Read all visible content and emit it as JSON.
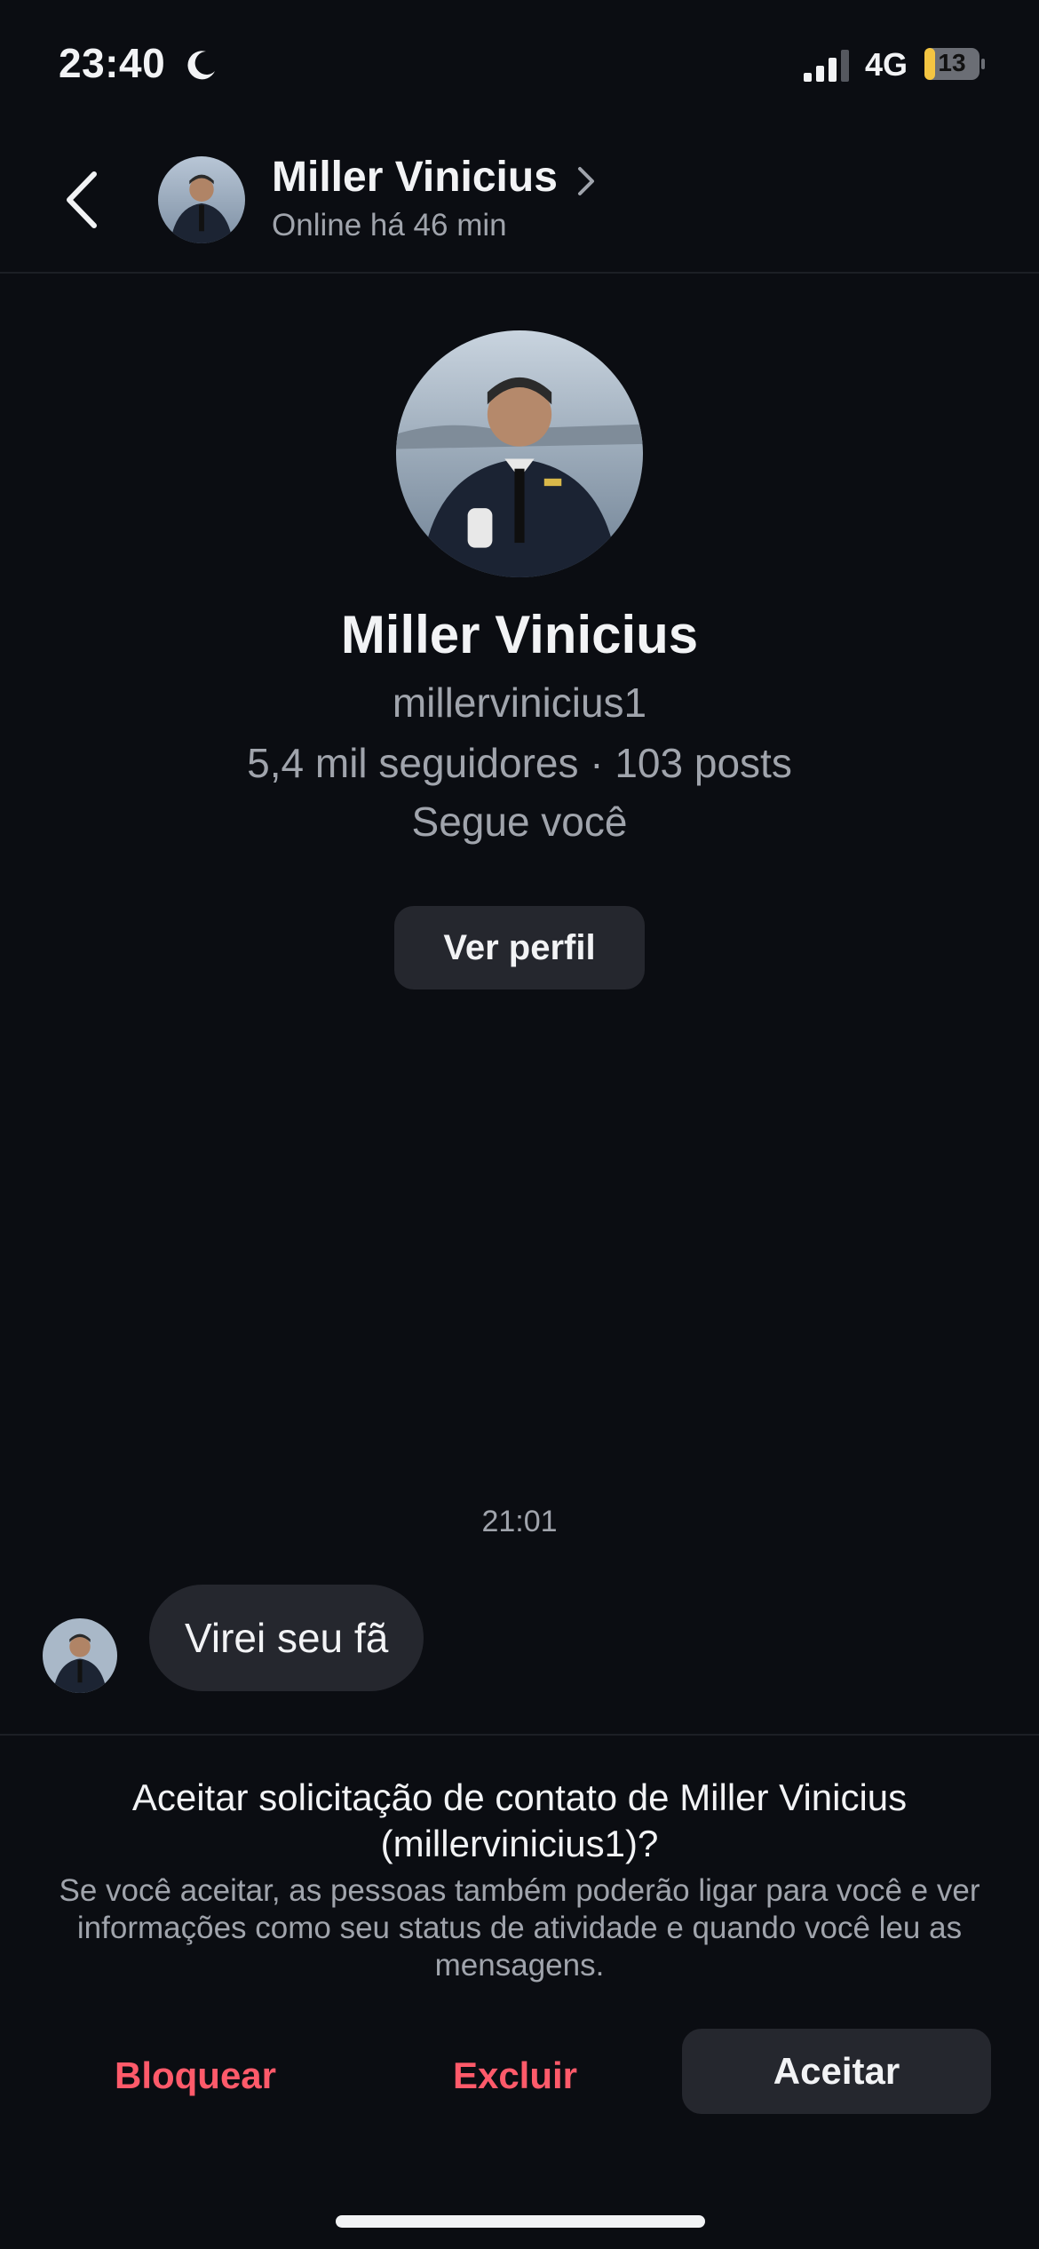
{
  "status_bar": {
    "time": "23:40",
    "network": "4G",
    "battery": "13",
    "icons": [
      "moon-icon",
      "signal-icon",
      "battery-icon"
    ]
  },
  "header": {
    "name": "Miller Vinicius",
    "status": "Online há 46 min",
    "icons": [
      "back-chevron-icon",
      "chevron-right-icon"
    ]
  },
  "profile": {
    "name": "Miller Vinicius",
    "username": "millervinicius1",
    "stats": "5,4 mil seguidores · 103 posts",
    "follow_status": "Segue você",
    "view_profile_label": "Ver perfil"
  },
  "messages": [
    {
      "time": "21:01",
      "text": "Virei seu fã"
    }
  ],
  "request": {
    "title_line1": "Aceitar solicitação de contato de Miller Vinicius",
    "title_line2": "(millervinicius1)?",
    "description": "Se você aceitar, as pessoas também poderão ligar para você e ver informações como seu status de atividade e quando você leu as mensagens.",
    "block_label": "Bloquear",
    "delete_label": "Excluir",
    "accept_label": "Aceitar"
  },
  "colors": {
    "background": "#0b0d12",
    "surface": "#25272e",
    "secondary_text": "#a0a4ac",
    "danger": "#ff5a6a",
    "battery_low": "#f4c542"
  }
}
